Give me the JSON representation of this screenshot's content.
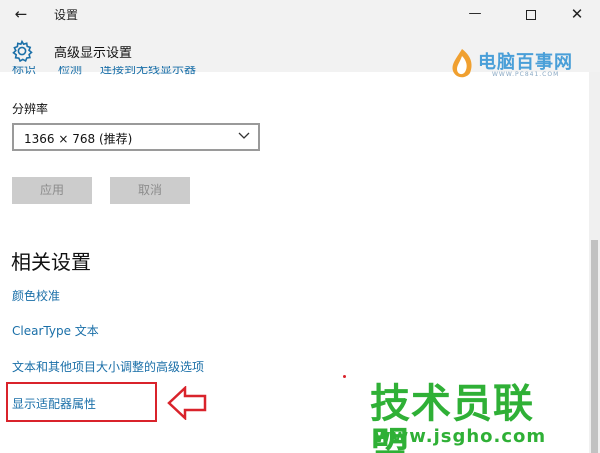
{
  "window": {
    "title": "设置",
    "back_glyph": "←",
    "minimize_glyph": "—",
    "close_glyph": "✕"
  },
  "header": {
    "title": "高级显示设置",
    "icon": "gear-icon"
  },
  "brand": {
    "name": "电脑百事网",
    "url": "WWW.PC841.COM"
  },
  "cut_links": [
    "标识",
    "检测",
    "连接到无线显示器"
  ],
  "resolution": {
    "label": "分辨率",
    "value": "1366 × 768 (推荐)"
  },
  "buttons": {
    "apply": "应用",
    "cancel": "取消"
  },
  "related": {
    "title": "相关设置",
    "links": [
      "颜色校准",
      "ClearType 文本",
      "文本和其他项目大小调整的高级选项",
      "显示适配器属性"
    ]
  },
  "watermark": {
    "name": "技术员联盟",
    "url": "www.jsgho.com"
  },
  "colors": {
    "link": "#1a6fa8",
    "highlight": "#d9232b",
    "watermark": "#2fb036"
  }
}
